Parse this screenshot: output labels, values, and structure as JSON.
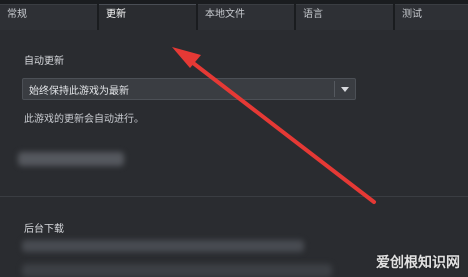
{
  "tabs": [
    {
      "label": "常规"
    },
    {
      "label": "更新"
    },
    {
      "label": "本地文件"
    },
    {
      "label": "语言"
    },
    {
      "label": "测试"
    }
  ],
  "auto_update": {
    "heading": "自动更新",
    "select_value": "始终保持此游戏为最新",
    "help_text": "此游戏的更新会自动进行。"
  },
  "background_download": {
    "heading": "后台下载"
  },
  "watermark": "爱创根知识网",
  "colors": {
    "arrow": "#e53935",
    "active_tab": "#2a2c30"
  },
  "icons": {
    "dropdown": "chevron-down-icon",
    "annotation": "arrow-icon"
  }
}
